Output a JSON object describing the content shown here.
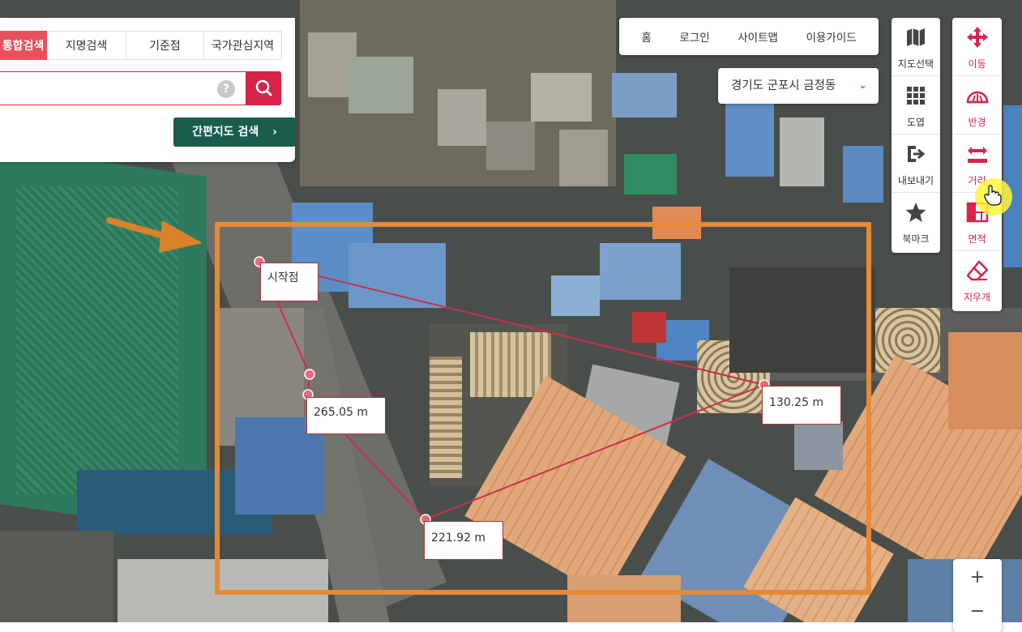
{
  "search_panel": {
    "tabs": [
      {
        "label": "통합검색",
        "active": true
      },
      {
        "label": "지명검색",
        "active": false
      },
      {
        "label": "기준점",
        "active": false
      },
      {
        "label": "국가관심지역",
        "active": false
      }
    ],
    "search_placeholder": "",
    "help_symbol": "?",
    "quick_search_label": "간편지도 검색",
    "quick_search_arrow": "›"
  },
  "top_nav": {
    "links": [
      "홈",
      "로그인",
      "사이트맵",
      "이용가이드"
    ]
  },
  "region_select": {
    "value": "경기도 군포시 금정동",
    "chevron": "⌄"
  },
  "toolbar_left": [
    {
      "label": "지도선택",
      "icon": "map-icon"
    },
    {
      "label": "도엽",
      "icon": "grid-icon"
    },
    {
      "label": "내보내기",
      "icon": "export-icon"
    },
    {
      "label": "북마크",
      "icon": "star-icon"
    }
  ],
  "toolbar_right": [
    {
      "label": "이동",
      "icon": "move-arrows-icon"
    },
    {
      "label": "반경",
      "icon": "radius-icon"
    },
    {
      "label": "거리",
      "icon": "distance-icon"
    },
    {
      "label": "면적",
      "icon": "area-icon"
    },
    {
      "label": "지우개",
      "icon": "eraser-icon"
    }
  ],
  "zoom": {
    "in": "+",
    "out": "−"
  },
  "measurement": {
    "start_label": "시작점",
    "segments": [
      "265.05 m",
      "221.92 m",
      "130.25 m"
    ]
  },
  "colors": {
    "accent": "#d7244a",
    "tab_active": "#e8505b",
    "quick_search": "#1a5d4b",
    "highlight": "#e58a37",
    "measure_line": "#c8304a"
  }
}
